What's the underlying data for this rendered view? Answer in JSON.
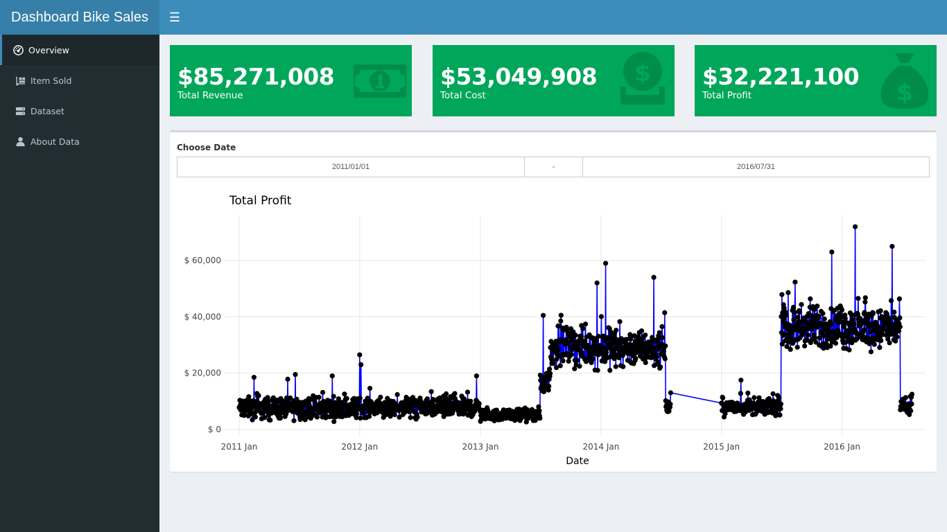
{
  "app": {
    "title": "Dashboard Bike Sales",
    "menu_icon": "hamburger-icon"
  },
  "sidebar": {
    "items": [
      {
        "label": "Overview",
        "icon": "dashboard-icon",
        "active": true
      },
      {
        "label": "Item Sold",
        "icon": "dolly-icon",
        "active": false
      },
      {
        "label": "Dataset",
        "icon": "server-icon",
        "active": false
      },
      {
        "label": "About Data",
        "icon": "user-icon",
        "active": false
      }
    ]
  },
  "value_boxes": [
    {
      "value": "$85,271,008",
      "label": "Total Revenue",
      "icon": "money-bill-icon",
      "color": "#00a65a"
    },
    {
      "value": "$53,049,908",
      "label": "Total Cost",
      "icon": "hand-coin-icon",
      "color": "#00a65a"
    },
    {
      "value": "$32,221,100",
      "label": "Total Profit",
      "icon": "money-bag-icon",
      "color": "#00a65a"
    }
  ],
  "date_filter": {
    "label": "Choose Date",
    "start": "2011/01/01",
    "separator": "-",
    "end": "2016/07/31"
  },
  "chart_data": {
    "type": "line",
    "title": "Total Profit",
    "xlabel": "Date",
    "ylabel": "",
    "x_ticks": [
      "2011 Jan",
      "2012 Jan",
      "2013 Jan",
      "2014 Jan",
      "2015 Jan",
      "2016 Jan"
    ],
    "y_ticks": [
      "$ 0",
      "$ 20,000",
      "$ 40,000",
      "$ 60,000"
    ],
    "ylim": [
      -2000,
      76000
    ],
    "xlim": [
      "2010-11-20",
      "2016-09-10"
    ],
    "line_color": "#0000ff",
    "marker_color": "#000000",
    "grid": true,
    "segments": [
      {
        "from": "2011-01-01",
        "to": "2011-12-31",
        "mean": 7500,
        "spread": 5500,
        "spikes": [
          [
            "2011-02-15",
            18500
          ],
          [
            "2011-06-20",
            19500
          ],
          [
            "2011-10-10",
            19000
          ]
        ]
      },
      {
        "from": "2012-01-01",
        "to": "2012-12-31",
        "mean": 7800,
        "spread": 5000,
        "spikes": [
          [
            "2012-01-01",
            26500
          ],
          [
            "2012-01-05",
            23000
          ],
          [
            "2012-12-20",
            19000
          ]
        ]
      },
      {
        "from": "2013-01-01",
        "to": "2013-06-30",
        "mean": 5000,
        "spread": 3000,
        "spikes": []
      },
      {
        "from": "2013-07-01",
        "to": "2013-07-31",
        "mean": 17000,
        "spread": 6000,
        "spikes": [
          [
            "2013-07-10",
            40500
          ]
        ]
      },
      {
        "from": "2013-08-01",
        "to": "2014-07-15",
        "mean": 29000,
        "spread": 9500,
        "spikes": [
          [
            "2013-12-20",
            52000
          ],
          [
            "2014-01-15",
            59000
          ],
          [
            "2014-06-10",
            54000
          ]
        ]
      },
      {
        "from": "2014-07-16",
        "to": "2014-07-31",
        "mean": 8000,
        "spread": 3500,
        "spikes": [
          [
            "2014-07-31",
            13000
          ]
        ]
      },
      {
        "from": "2015-01-01",
        "to": "2015-06-30",
        "mean": 8000,
        "spread": 4000,
        "spikes": [
          [
            "2015-03-01",
            17500
          ]
        ]
      },
      {
        "from": "2015-07-01",
        "to": "2016-06-25",
        "mean": 36000,
        "spread": 11000,
        "spikes": [
          [
            "2015-12-01",
            63000
          ],
          [
            "2016-02-10",
            72000
          ],
          [
            "2016-06-01",
            65000
          ]
        ]
      },
      {
        "from": "2016-06-26",
        "to": "2016-07-31",
        "mean": 8000,
        "spread": 4000,
        "spikes": [
          [
            "2016-07-31",
            12500
          ]
        ]
      }
    ]
  }
}
